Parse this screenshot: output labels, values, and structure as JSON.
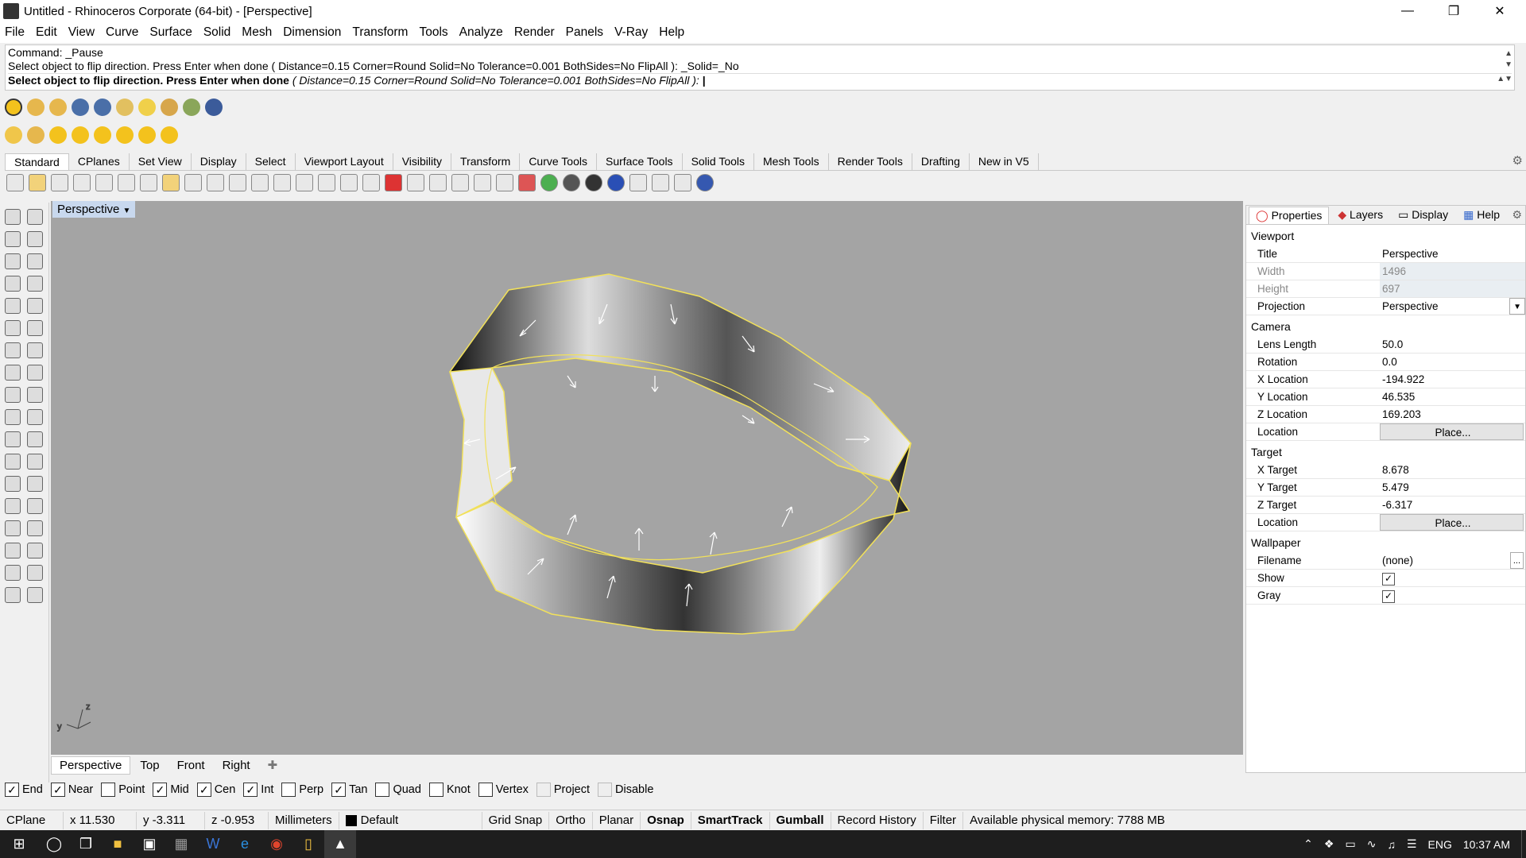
{
  "window": {
    "title": "Untitled - Rhinoceros Corporate (64-bit) - [Perspective]"
  },
  "menu": [
    "File",
    "Edit",
    "View",
    "Curve",
    "Surface",
    "Solid",
    "Mesh",
    "Dimension",
    "Transform",
    "Tools",
    "Analyze",
    "Render",
    "Panels",
    "V-Ray",
    "Help"
  ],
  "command": {
    "line1": "Command: _Pause",
    "line2": "Select object to flip direction. Press Enter when done ( Distance=0.15  Corner=Round  Solid=No  Tolerance=0.001  BothSides=No  FlipAll ): _Solid=_No",
    "prompt": "Select object to flip direction. Press Enter when done",
    "options": "( Distance=0.15  Corner=Round  Solid=No  Tolerance=0.001  BothSides=No  FlipAll ):"
  },
  "toolbar_tabs": [
    "Standard",
    "CPlanes",
    "Set View",
    "Display",
    "Select",
    "Viewport Layout",
    "Visibility",
    "Transform",
    "Curve Tools",
    "Surface Tools",
    "Solid Tools",
    "Mesh Tools",
    "Render Tools",
    "Drafting",
    "New in V5"
  ],
  "viewport": {
    "label": "Perspective"
  },
  "viewport_tabs": [
    "Perspective",
    "Top",
    "Front",
    "Right"
  ],
  "osnaps": [
    {
      "label": "End",
      "checked": true
    },
    {
      "label": "Near",
      "checked": true
    },
    {
      "label": "Point",
      "checked": false
    },
    {
      "label": "Mid",
      "checked": true
    },
    {
      "label": "Cen",
      "checked": true
    },
    {
      "label": "Int",
      "checked": true
    },
    {
      "label": "Perp",
      "checked": false
    },
    {
      "label": "Tan",
      "checked": true
    },
    {
      "label": "Quad",
      "checked": false
    },
    {
      "label": "Knot",
      "checked": false
    },
    {
      "label": "Vertex",
      "checked": false
    },
    {
      "label": "Project",
      "checked": false,
      "disabled": true
    },
    {
      "label": "Disable",
      "checked": false,
      "disabled": true
    }
  ],
  "status": {
    "cplane": "CPlane",
    "x": "x 11.530",
    "y": "y -3.311",
    "z": "z -0.953",
    "units": "Millimeters",
    "layer": "Default",
    "grid_snap": "Grid Snap",
    "ortho": "Ortho",
    "planar": "Planar",
    "osnap": "Osnap",
    "smarttrack": "SmartTrack",
    "gumball": "Gumball",
    "record_history": "Record History",
    "filter": "Filter",
    "memory": "Available physical memory: 7788 MB"
  },
  "panel": {
    "tabs": [
      "Properties",
      "Layers",
      "Display",
      "Help"
    ],
    "viewport_header": "Viewport",
    "title_label": "Title",
    "title_value": "Perspective",
    "width_label": "Width",
    "width_value": "1496",
    "height_label": "Height",
    "height_value": "697",
    "projection_label": "Projection",
    "projection_value": "Perspective",
    "camera_header": "Camera",
    "lens_label": "Lens Length",
    "lens_value": "50.0",
    "rotation_label": "Rotation",
    "rotation_value": "0.0",
    "xloc_label": "X Location",
    "xloc_value": "-194.922",
    "yloc_label": "Y Location",
    "yloc_value": "46.535",
    "zloc_label": "Z Location",
    "zloc_value": "169.203",
    "location_label": "Location",
    "place_label": "Place...",
    "target_header": "Target",
    "xt_label": "X Target",
    "xt_value": "8.678",
    "yt_label": "Y Target",
    "yt_value": "5.479",
    "zt_label": "Z Target",
    "zt_value": "-6.317",
    "tlocation_label": "Location",
    "tplace_label": "Place...",
    "wallpaper_header": "Wallpaper",
    "filename_label": "Filename",
    "filename_value": "(none)",
    "show_label": "Show",
    "gray_label": "Gray"
  },
  "taskbar": {
    "lang": "ENG",
    "time": "10:37 AM"
  }
}
